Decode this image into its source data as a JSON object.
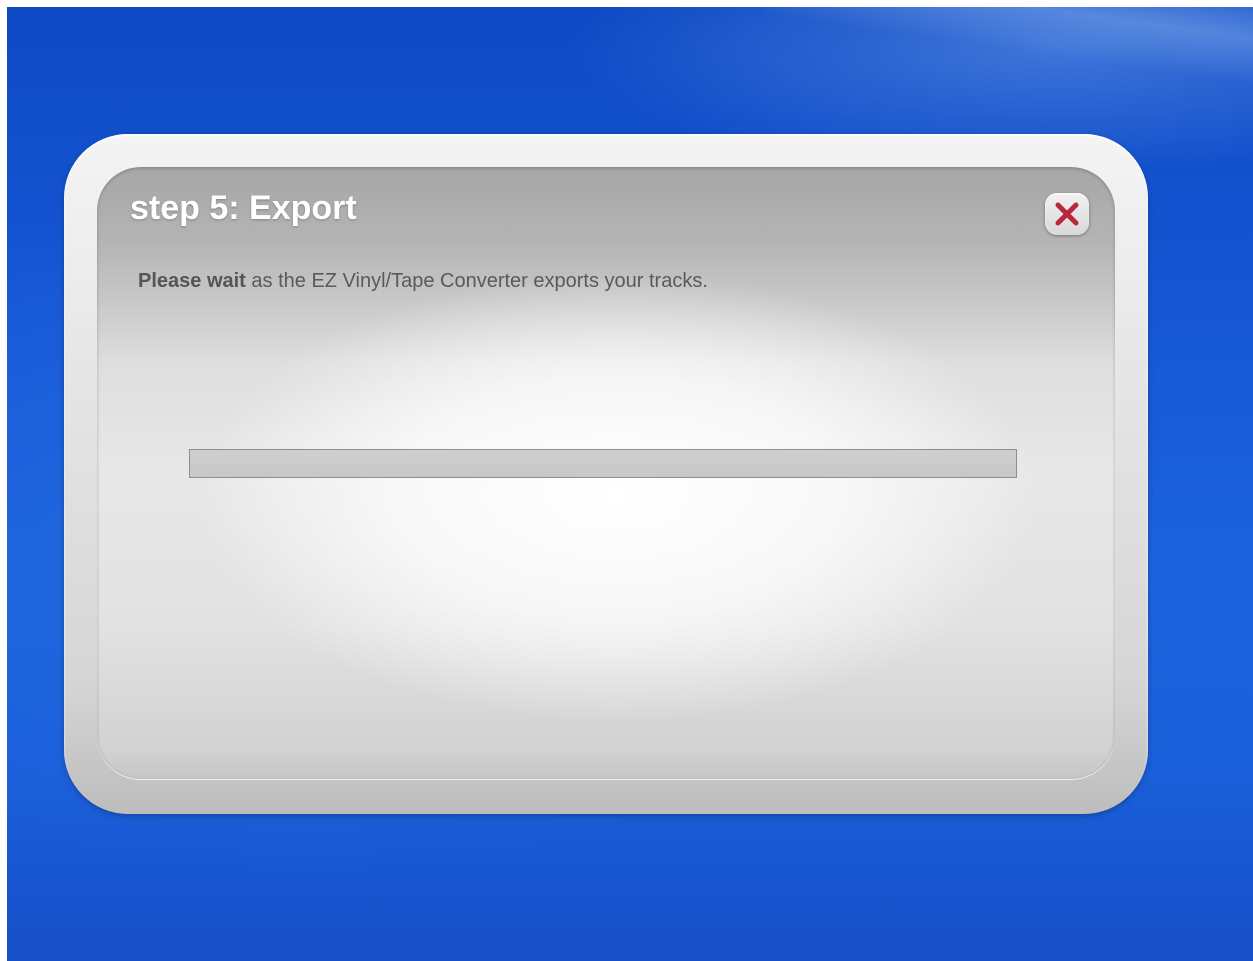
{
  "dialog": {
    "title": "step 5: Export",
    "message_bold": "Please wait",
    "message_rest": " as the EZ Vinyl/Tape Converter exports your tracks.",
    "close_icon": "close-x-icon",
    "progress": 0
  },
  "colors": {
    "desktop_blue": "#1758d6",
    "title_text": "#ffffff",
    "close_x": "#b8283a",
    "progress_track": "#c9c9c9"
  }
}
